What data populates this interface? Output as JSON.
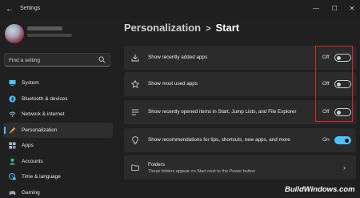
{
  "window": {
    "title": "Settings",
    "back_label": "←",
    "controls": {
      "minimize": "—",
      "maximize": "☐",
      "close": "✕"
    }
  },
  "sidebar": {
    "search_placeholder": "Find a setting",
    "items": [
      {
        "label": "System",
        "icon": "monitor-icon",
        "color": "#4cc2ff"
      },
      {
        "label": "Bluetooth & devices",
        "icon": "bluetooth-icon",
        "color": "#4cc2ff"
      },
      {
        "label": "Network & internet",
        "icon": "wifi-icon",
        "color": "#b0c4de"
      },
      {
        "label": "Personalization",
        "icon": "brush-icon",
        "color": "#e8a24a",
        "active": true
      },
      {
        "label": "Apps",
        "icon": "apps-icon",
        "color": "#b0b8c8"
      },
      {
        "label": "Accounts",
        "icon": "person-icon",
        "color": "#3fbf7f"
      },
      {
        "label": "Time & language",
        "icon": "globe-clock-icon",
        "color": "#4cc2ff"
      },
      {
        "label": "Gaming",
        "icon": "controller-icon",
        "color": "#9aa4b0"
      }
    ]
  },
  "main": {
    "breadcrumb": {
      "parent": "Personalization",
      "separator": ">",
      "current": "Start"
    },
    "settings": [
      {
        "label": "Show recently added apps",
        "state": "Off",
        "on": false,
        "icon": "download-icon"
      },
      {
        "label": "Show most used apps",
        "state": "Off",
        "on": false,
        "icon": "star-icon"
      },
      {
        "label": "Show recently opened items in Start, Jump Lists, and File Explorer",
        "state": "Off",
        "on": false,
        "icon": "list-icon"
      },
      {
        "label": "Show recommendations for tips, shortcuts, new apps, and more",
        "state": "On",
        "on": true,
        "icon": "bulb-icon"
      }
    ],
    "folders": {
      "label": "Folders",
      "sublabel": "These folders appear on Start next to the Power button",
      "icon": "folder-icon"
    }
  },
  "watermark": "BuildWindows.com",
  "colors": {
    "accent": "#4cc2ff",
    "highlight": "#e0202a",
    "background": "#202020",
    "card": "#2b2b2b"
  }
}
